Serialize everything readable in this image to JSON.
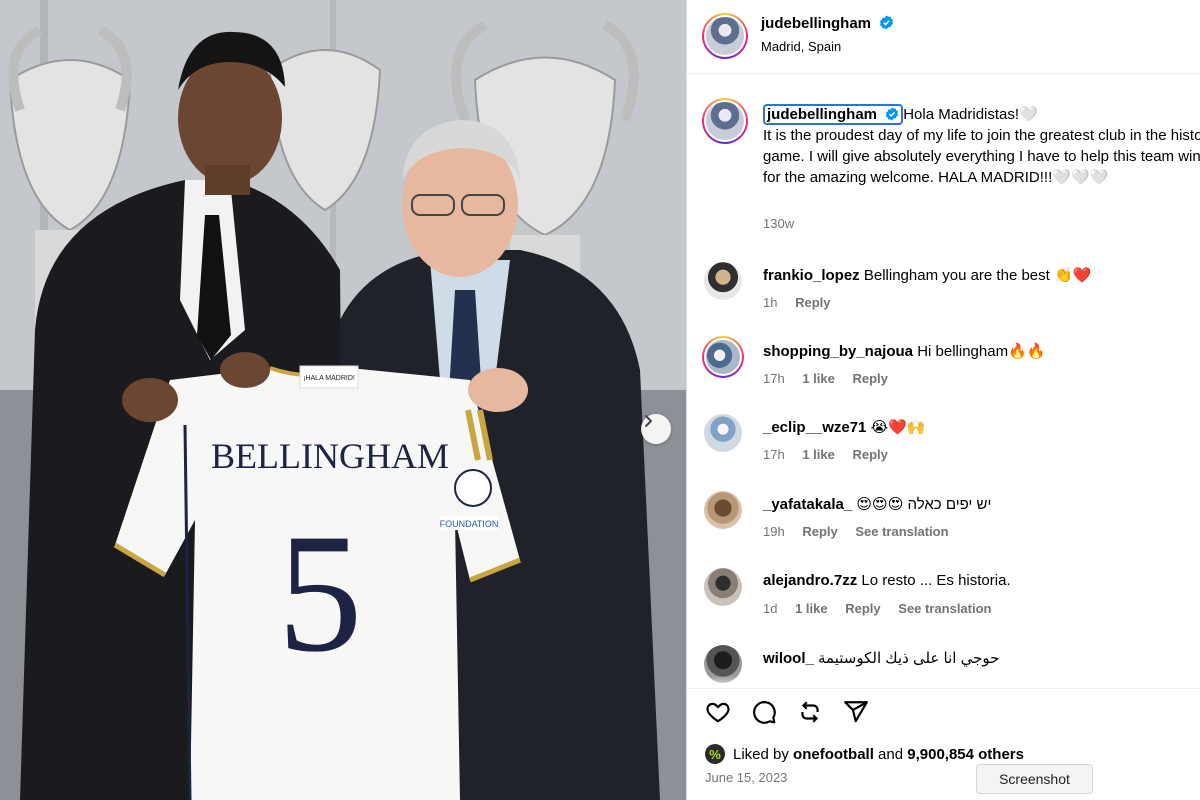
{
  "photo": {
    "jersey_name": "BELLINGHAM",
    "jersey_number": "5",
    "jersey_tag": "¡HALA MADRID!",
    "foundation_badge": "FOUNDATION",
    "next_icon": "chevron-right-icon"
  },
  "header": {
    "username": "judebellingham",
    "location": "Madrid, Spain",
    "verified_icon": "verified-badge-icon"
  },
  "caption": {
    "username": "judebellingham",
    "text_line1": "Hola Madridistas!🤍",
    "text_body": "It is the proudest day of my life to join the greatest club in the history of the game. I will give absolutely everything I have to help this team win. Thank you for the amazing welcome. HALA MADRID!!!🤍🤍🤍",
    "time": "130w"
  },
  "comments": [
    {
      "user": "frankio_lopez",
      "text": "Bellingham you are the best 👏❤️",
      "time": "1h",
      "likes": "",
      "reply": "Reply",
      "translate": ""
    },
    {
      "user": "shopping_by_najoua",
      "text": "Hi bellingham🔥🔥",
      "time": "17h",
      "likes": "1 like",
      "reply": "Reply",
      "translate": ""
    },
    {
      "user": "_eclip__wze71",
      "text": "😭❤️🙌",
      "time": "17h",
      "likes": "1 like",
      "reply": "Reply",
      "translate": ""
    },
    {
      "user": "_yafatakala_",
      "text": "😍😍😍 יש יפים כאלה",
      "time": "19h",
      "likes": "",
      "reply": "Reply",
      "translate": "See translation"
    },
    {
      "user": "alejandro.7zz",
      "text": "Lo resto ... Es historia.",
      "time": "1d",
      "likes": "1 like",
      "reply": "Reply",
      "translate": "See translation"
    },
    {
      "user": "wilool_",
      "text": "حوجي انا على ذيك الكوستيمة",
      "time": "",
      "likes": "",
      "reply": "",
      "translate": ""
    }
  ],
  "actions": {
    "like_icon": "heart-icon",
    "comment_icon": "comment-icon",
    "repost_icon": "repost-icon",
    "share_icon": "share-icon"
  },
  "likes": {
    "prefix": "Liked by",
    "user": "onefootball",
    "and": "and",
    "count": "9,900,854 others",
    "liker_avatar_glyph": "%"
  },
  "date": "June 15, 2023",
  "tooltip": "Screenshot"
}
